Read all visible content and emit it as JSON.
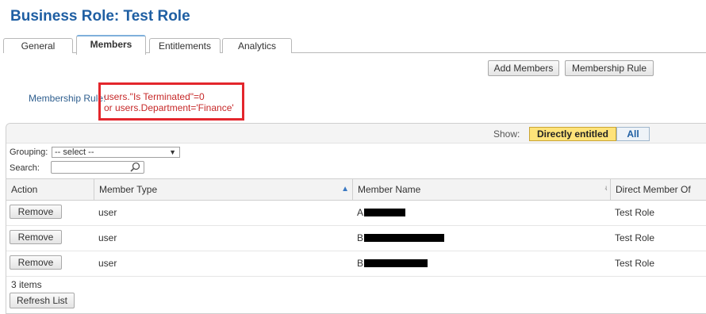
{
  "page": {
    "title": "Business Role: Test Role"
  },
  "tabs": [
    {
      "label": "General"
    },
    {
      "label": "Members"
    },
    {
      "label": "Entitlements"
    },
    {
      "label": "Analytics"
    }
  ],
  "actions": {
    "add_members": "Add Members",
    "membership_rule": "Membership Rule"
  },
  "membership": {
    "label": "Membership Rule:",
    "rule_line1": "users.\"Is Terminated\"=0",
    "rule_line2": "or users.Department='Finance'"
  },
  "filter": {
    "show_label": "Show:",
    "options": [
      "Directly entitled",
      "All"
    ],
    "selected": "Directly entitled",
    "grouping_label": "Grouping:",
    "grouping_value": "-- select --",
    "search_label": "Search:",
    "search_value": ""
  },
  "table": {
    "columns": [
      "Action",
      "Member Type",
      "Member Name",
      "Direct Member Of"
    ],
    "rows": [
      {
        "action": "Remove",
        "type": "user",
        "name_visible": "A",
        "member_of": "Test Role"
      },
      {
        "action": "Remove",
        "type": "user",
        "name_visible": "B",
        "member_of": "Test Role"
      },
      {
        "action": "Remove",
        "type": "user",
        "name_visible": "B",
        "member_of": "Test Role"
      }
    ]
  },
  "footer": {
    "count": "3 items",
    "refresh": "Refresh List"
  },
  "colors": {
    "title": "#1f5fa3",
    "highlight": "#e3262c",
    "rule_text": "#c62828",
    "selected_toggle": "#ffe37a"
  },
  "icons": {
    "search": "search-icon",
    "sort": "sort-asc-icon",
    "column_resize": "column-resize-icon",
    "dropdown": "chevron-down-icon"
  }
}
